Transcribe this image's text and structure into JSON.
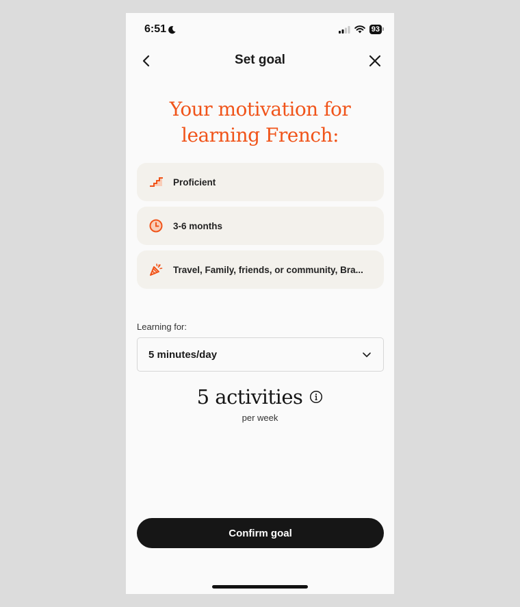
{
  "status_bar": {
    "time": "6:51",
    "battery": "93",
    "icons": [
      "moon-icon",
      "signal-icon",
      "wifi-icon",
      "battery-icon"
    ]
  },
  "nav": {
    "title": "Set goal",
    "back_icon": "chevron-left-icon",
    "close_icon": "close-icon"
  },
  "headline": {
    "line1": "Your motivation for",
    "line2": "learning French:"
  },
  "cards": [
    {
      "icon": "stairs-icon",
      "label": "Proficient"
    },
    {
      "icon": "clock-icon",
      "label": "3-6 months"
    },
    {
      "icon": "party-popper-icon",
      "label": "Travel, Family, friends, or community, Bra..."
    }
  ],
  "learning": {
    "label": "Learning for:",
    "selected": "5 minutes/day"
  },
  "activities": {
    "count_text": "5 activities",
    "subtitle": "per week"
  },
  "confirm_button": "Confirm goal",
  "colors": {
    "accent": "#f0541a",
    "card_bg": "#f3f1ec",
    "button_bg": "#161616"
  }
}
